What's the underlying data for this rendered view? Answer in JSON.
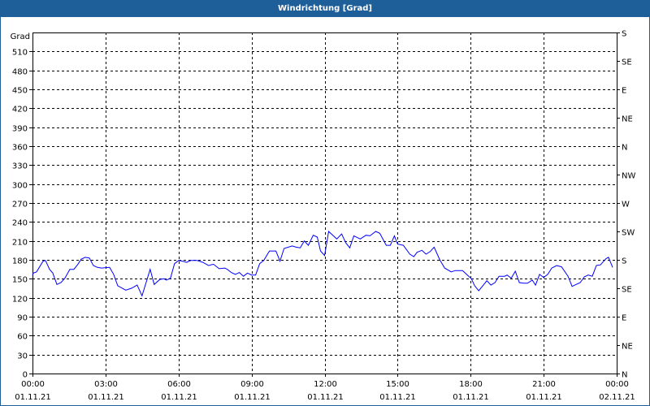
{
  "window": {
    "title": "Windrichtung [Grad]"
  },
  "colors": {
    "titlebar": "#1e5f99",
    "line": "#0000ff",
    "grid": "#000000"
  },
  "chart_data": {
    "type": "line",
    "title": "Windrichtung [Grad]",
    "ylabel": "Grad",
    "ylim": [
      0,
      540
    ],
    "y_ticks": [
      0,
      30,
      60,
      90,
      120,
      150,
      180,
      210,
      240,
      270,
      300,
      330,
      360,
      390,
      420,
      450,
      480,
      510
    ],
    "right_axis_labels": [
      "S",
      "SE",
      "E",
      "NE",
      "N",
      "NW",
      "W",
      "SW",
      "S",
      "SE",
      "E",
      "NE",
      "N"
    ],
    "x_unit": "minutes since 01.11.21 00:00",
    "xlim": [
      0,
      1440
    ],
    "x_ticks": [
      {
        "time": "00:00",
        "date": "01.11.21"
      },
      {
        "time": "03:00",
        "date": "01.11.21"
      },
      {
        "time": "06:00",
        "date": "01.11.21"
      },
      {
        "time": "09:00",
        "date": "01.11.21"
      },
      {
        "time": "12:00",
        "date": "01.11.21"
      },
      {
        "time": "15:00",
        "date": "01.11.21"
      },
      {
        "time": "18:00",
        "date": "01.11.21"
      },
      {
        "time": "21:00",
        "date": "01.11.21"
      },
      {
        "time": "00:00",
        "date": "02.11.21"
      }
    ],
    "grid": true,
    "series": [
      {
        "name": "Windrichtung",
        "points": [
          [
            0,
            155
          ],
          [
            2,
            159
          ],
          [
            10,
            161
          ],
          [
            26,
            178
          ],
          [
            32,
            179
          ],
          [
            42,
            165
          ],
          [
            50,
            159
          ],
          [
            60,
            141
          ],
          [
            70,
            144
          ],
          [
            80,
            151
          ],
          [
            92,
            165
          ],
          [
            102,
            165
          ],
          [
            112,
            173
          ],
          [
            120,
            181
          ],
          [
            130,
            184
          ],
          [
            140,
            183
          ],
          [
            150,
            171
          ],
          [
            160,
            168
          ],
          [
            170,
            167
          ],
          [
            190,
            168
          ],
          [
            200,
            157
          ],
          [
            210,
            139
          ],
          [
            230,
            132
          ],
          [
            244,
            135
          ],
          [
            258,
            140
          ],
          [
            270,
            123
          ],
          [
            280,
            144
          ],
          [
            290,
            165
          ],
          [
            300,
            141
          ],
          [
            314,
            149
          ],
          [
            324,
            150
          ],
          [
            330,
            148
          ],
          [
            340,
            151
          ],
          [
            350,
            174
          ],
          [
            360,
            179
          ],
          [
            370,
            178
          ],
          [
            380,
            176
          ],
          [
            390,
            179
          ],
          [
            406,
            179
          ],
          [
            420,
            176
          ],
          [
            434,
            171
          ],
          [
            446,
            173
          ],
          [
            460,
            166
          ],
          [
            474,
            167
          ],
          [
            480,
            165
          ],
          [
            490,
            160
          ],
          [
            500,
            157
          ],
          [
            510,
            160
          ],
          [
            520,
            154
          ],
          [
            530,
            159
          ],
          [
            540,
            156
          ],
          [
            550,
            156
          ],
          [
            560,
            174
          ],
          [
            570,
            179
          ],
          [
            584,
            194
          ],
          [
            600,
            194
          ],
          [
            610,
            178
          ],
          [
            620,
            198
          ],
          [
            640,
            202
          ],
          [
            650,
            200
          ],
          [
            660,
            199
          ],
          [
            670,
            210
          ],
          [
            680,
            203
          ],
          [
            692,
            219
          ],
          [
            702,
            216
          ],
          [
            710,
            194
          ],
          [
            720,
            187
          ],
          [
            730,
            225
          ],
          [
            750,
            213
          ],
          [
            762,
            221
          ],
          [
            772,
            207
          ],
          [
            782,
            199
          ],
          [
            792,
            218
          ],
          [
            808,
            213
          ],
          [
            822,
            219
          ],
          [
            832,
            218
          ],
          [
            846,
            225
          ],
          [
            856,
            222
          ],
          [
            872,
            203
          ],
          [
            882,
            203
          ],
          [
            892,
            218
          ],
          [
            900,
            205
          ],
          [
            914,
            203
          ],
          [
            930,
            189
          ],
          [
            940,
            185
          ],
          [
            948,
            192
          ],
          [
            960,
            195
          ],
          [
            970,
            189
          ],
          [
            980,
            193
          ],
          [
            990,
            200
          ],
          [
            1004,
            180
          ],
          [
            1016,
            167
          ],
          [
            1032,
            161
          ],
          [
            1042,
            163
          ],
          [
            1060,
            163
          ],
          [
            1070,
            157
          ],
          [
            1082,
            150
          ],
          [
            1090,
            139
          ],
          [
            1100,
            131
          ],
          [
            1110,
            139
          ],
          [
            1120,
            147
          ],
          [
            1130,
            140
          ],
          [
            1140,
            144
          ],
          [
            1150,
            154
          ],
          [
            1164,
            154
          ],
          [
            1170,
            156
          ],
          [
            1180,
            151
          ],
          [
            1190,
            162
          ],
          [
            1200,
            144
          ],
          [
            1210,
            143
          ],
          [
            1220,
            143
          ],
          [
            1232,
            148
          ],
          [
            1240,
            140
          ],
          [
            1250,
            157
          ],
          [
            1260,
            152
          ],
          [
            1270,
            157
          ],
          [
            1280,
            167
          ],
          [
            1292,
            171
          ],
          [
            1304,
            169
          ],
          [
            1320,
            154
          ],
          [
            1330,
            138
          ],
          [
            1340,
            141
          ],
          [
            1350,
            144
          ],
          [
            1360,
            153
          ],
          [
            1370,
            156
          ],
          [
            1380,
            154
          ],
          [
            1390,
            171
          ],
          [
            1400,
            172
          ],
          [
            1414,
            182
          ],
          [
            1420,
            184
          ],
          [
            1430,
            168
          ]
        ]
      }
    ]
  }
}
